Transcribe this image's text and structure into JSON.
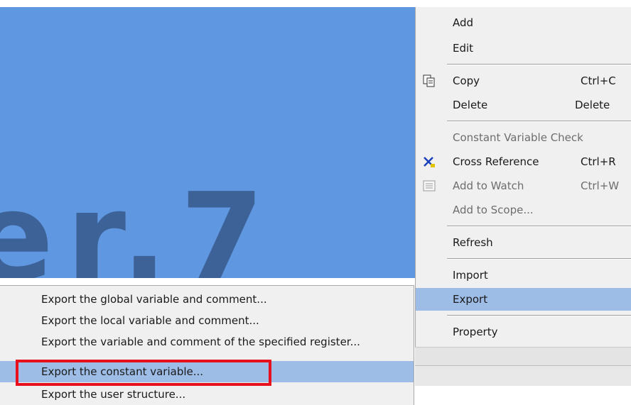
{
  "splash": {
    "text": "er.7"
  },
  "context_menu": {
    "items": [
      {
        "label": "Add",
        "shortcut": ""
      },
      {
        "label": "Edit",
        "shortcut": ""
      },
      {
        "label": "Copy",
        "shortcut": "Ctrl+C",
        "icon": "copy-icon"
      },
      {
        "label": "Delete",
        "shortcut": "Delete"
      },
      {
        "label": "Constant Variable Check",
        "shortcut": "",
        "disabled": true
      },
      {
        "label": "Cross Reference",
        "shortcut": "Ctrl+R",
        "icon": "cross-reference-icon"
      },
      {
        "label": "Add to Watch",
        "shortcut": "Ctrl+W",
        "disabled": true,
        "icon": "watch-icon"
      },
      {
        "label": "Add to Scope...",
        "shortcut": "",
        "disabled": true
      },
      {
        "label": "Refresh",
        "shortcut": ""
      },
      {
        "label": "Import",
        "shortcut": ""
      },
      {
        "label": "Export",
        "shortcut": "",
        "highlighted": true
      },
      {
        "label": "Property",
        "shortcut": ""
      }
    ]
  },
  "export_submenu": {
    "items": [
      {
        "label": "Export the global variable and comment..."
      },
      {
        "label": "Export the local variable and comment..."
      },
      {
        "label": "Export the variable and comment of the specified register..."
      },
      {
        "label": "Export the constant variable...",
        "highlighted": true
      },
      {
        "label": "Export the user structure..."
      }
    ]
  },
  "annotation": {
    "color": "#e8101d",
    "target": "Export the constant variable..."
  }
}
